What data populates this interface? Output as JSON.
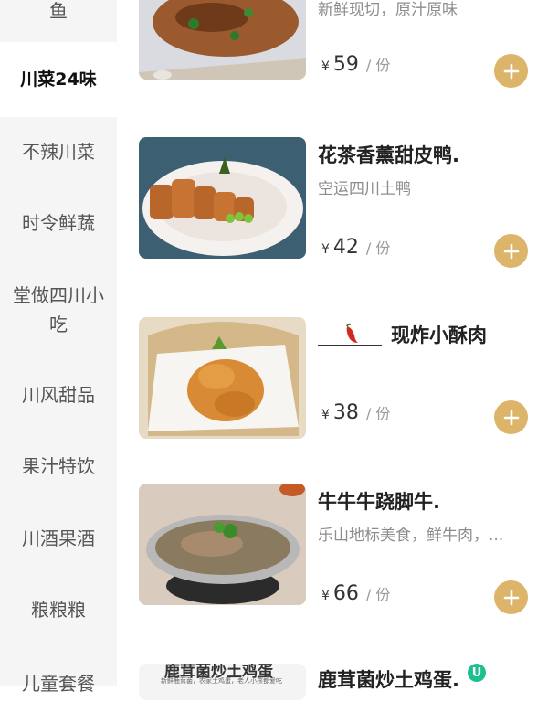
{
  "sidebar": {
    "categories": [
      "鱼",
      "川菜24味",
      "不辣川菜",
      "时令鲜蔬",
      "堂做四川小吃",
      "川风甜品",
      "果汁特饮",
      "川酒果酒",
      "粮粮粮",
      "儿童套餐"
    ],
    "active_index": 1
  },
  "items": [
    {
      "name": "",
      "desc": "新鲜现切，原汁原味",
      "currency": "¥",
      "price": "59",
      "unit": "/ 份",
      "add_label": "+"
    },
    {
      "name": "花茶香薰甜皮鸭.",
      "desc": "空运四川土鸭",
      "currency": "¥",
      "price": "42",
      "unit": "/ 份",
      "add_label": "+"
    },
    {
      "name": "现炸小酥肉",
      "desc": "",
      "currency": "¥",
      "price": "38",
      "unit": "/ 份",
      "add_label": "+",
      "spicy_icon": "chili-pepper-icon"
    },
    {
      "name": "牛牛牛跷脚牛.",
      "desc": "乐山地标美食，鲜牛肉，...",
      "currency": "¥",
      "price": "66",
      "unit": "/ 份",
      "add_label": "+"
    },
    {
      "name": "鹿茸菌炒土鸡蛋.",
      "desc": "",
      "badge": "U",
      "thumb_title": "鹿茸菌炒土鸡蛋",
      "thumb_subtitle": "新鲜鹿茸菌，农家土鸡蛋，老人小孩都爱吃"
    }
  ],
  "colors": {
    "accent": "#dcb46a",
    "sidebar_bg": "#f5f5f5",
    "badge": "#1cbf8f"
  }
}
